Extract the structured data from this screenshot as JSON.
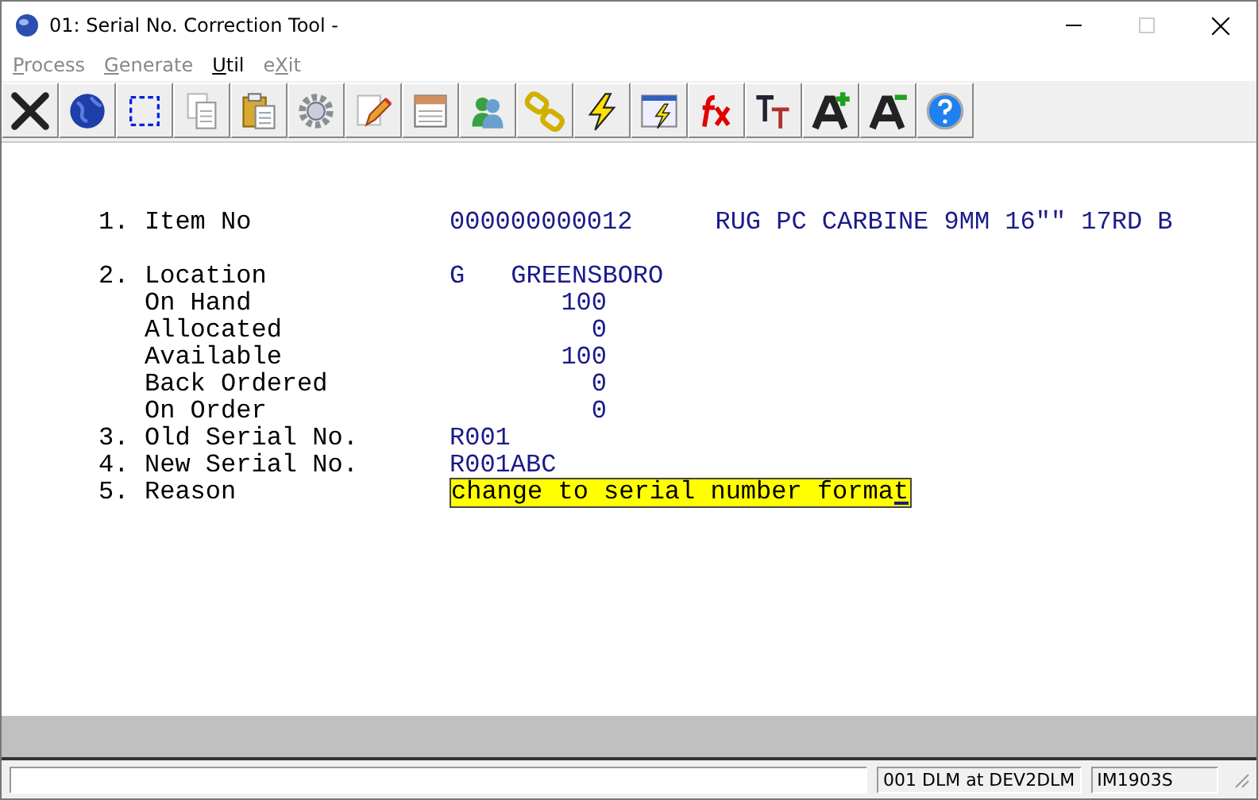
{
  "window": {
    "title": "01: Serial No. Correction Tool -",
    "maximize_disabled": true
  },
  "menu": [
    {
      "key": "P",
      "rest": "rocess",
      "disabled": true
    },
    {
      "key": "G",
      "rest": "enerate",
      "disabled": true
    },
    {
      "key": "U",
      "rest": "til",
      "disabled": false
    },
    {
      "before": "e",
      "key": "X",
      "rest": "it",
      "disabled": true
    }
  ],
  "toolbar": [
    {
      "kind": "cross"
    },
    {
      "kind": "globe"
    },
    {
      "kind": "select"
    },
    {
      "kind": "copy"
    },
    {
      "kind": "paste"
    },
    {
      "kind": "gear"
    },
    {
      "kind": "edit"
    },
    {
      "kind": "notes"
    },
    {
      "kind": "users"
    },
    {
      "kind": "link"
    },
    {
      "kind": "bolt"
    },
    {
      "kind": "run"
    },
    {
      "kind": "fx"
    },
    {
      "kind": "text-size"
    },
    {
      "kind": "font-up"
    },
    {
      "kind": "font-down"
    },
    {
      "kind": "help"
    }
  ],
  "fields": [
    {
      "kind": "text",
      "number": "1.",
      "label": "Item No",
      "value": "000000000012",
      "description": "RUG PC CARBINE 9MM 16\"\" 17RD B",
      "gap_after": true
    },
    {
      "kind": "text",
      "number": "2.",
      "label": "Location",
      "value": "G",
      "description": "GREENSBORO"
    },
    {
      "kind": "quantity",
      "label": "On Hand",
      "value": "100"
    },
    {
      "kind": "quantity",
      "label": "Allocated",
      "value": "0"
    },
    {
      "kind": "quantity",
      "label": "Available",
      "value": "100"
    },
    {
      "kind": "quantity",
      "label": "Back Ordered",
      "value": "0"
    },
    {
      "kind": "quantity",
      "label": "On Order",
      "value": "0"
    },
    {
      "kind": "text",
      "number": "3.",
      "label": "Old Serial No.",
      "value": "R001"
    },
    {
      "kind": "text",
      "number": "4.",
      "label": "New Serial No.",
      "value": "R001ABC"
    },
    {
      "kind": "input",
      "number": "5.",
      "label": "Reason",
      "value": "change to serial number format"
    }
  ],
  "status_bar": {
    "user": "001 DLM at DEV2DLM",
    "program": "IM1903S"
  }
}
